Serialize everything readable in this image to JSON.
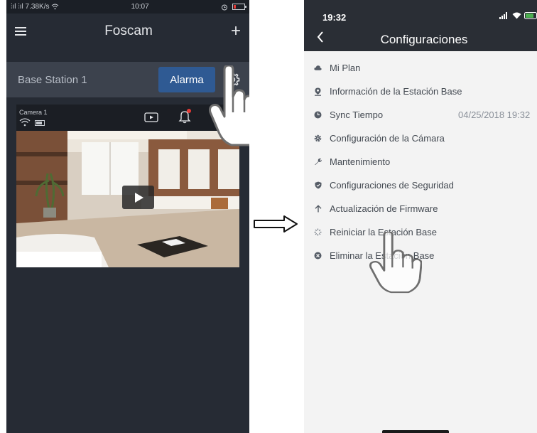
{
  "left_screen": {
    "status_bar": {
      "signal": "专ıl 专ıl 7.38K/s",
      "time": "10:07"
    },
    "app_title": "Foscam",
    "base_station": {
      "name": "Base Station 1",
      "alarm_button": "Alarma"
    },
    "camera": {
      "name": "Camera 1"
    }
  },
  "right_screen": {
    "status_time": "19:32",
    "title": "Configuraciones",
    "items": [
      {
        "label": "Mi Plan",
        "icon": "cloud-icon"
      },
      {
        "label": "Información de la Estación Base",
        "icon": "location-pin-icon"
      },
      {
        "label": "Sync Tiempo",
        "icon": "clock-icon",
        "value": "04/25/2018 19:32"
      },
      {
        "label": "Configuración de la Cámara",
        "icon": "gear-icon"
      },
      {
        "label": "Mantenimiento",
        "icon": "wrench-icon"
      },
      {
        "label": "Configuraciones de Seguridad",
        "icon": "shield-icon"
      },
      {
        "label": "Actualización de Firmware",
        "icon": "arrow-up-icon"
      },
      {
        "label": "Reiniciar la Estación Base",
        "icon": "restart-spinner-icon"
      },
      {
        "label": "Eliminar la Estación Base",
        "icon": "delete-icon"
      }
    ]
  },
  "colors": {
    "left_bg": "#262b34",
    "alarm_button": "#2f5a93",
    "right_header": "#2a2e35",
    "right_bg": "#f3f3f3"
  }
}
